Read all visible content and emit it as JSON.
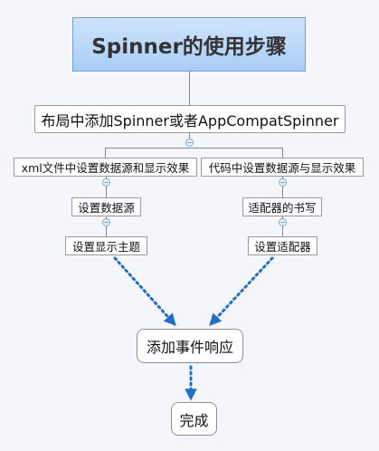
{
  "diagram": {
    "title": "Spinner的使用步骤",
    "step_layout": "布局中添加Spinner或者AppCompatSpinner",
    "branch_left": {
      "header": "xml文件中设置数据源和显示效果",
      "items": [
        "设置数据源",
        "设置显示主题"
      ]
    },
    "branch_right": {
      "header": "代码中设置数据源与显示效果",
      "items": [
        "适配器的书写",
        "设置适配器"
      ]
    },
    "step_event": "添加事件响应",
    "step_done": "完成"
  },
  "toggle_glyph": "−",
  "colors": {
    "title_fill": "#a9cdf6",
    "title_border": "#6f9fd6",
    "line": "#888888",
    "arrow": "#1f6fc9",
    "toggle": "#2f6db5"
  }
}
